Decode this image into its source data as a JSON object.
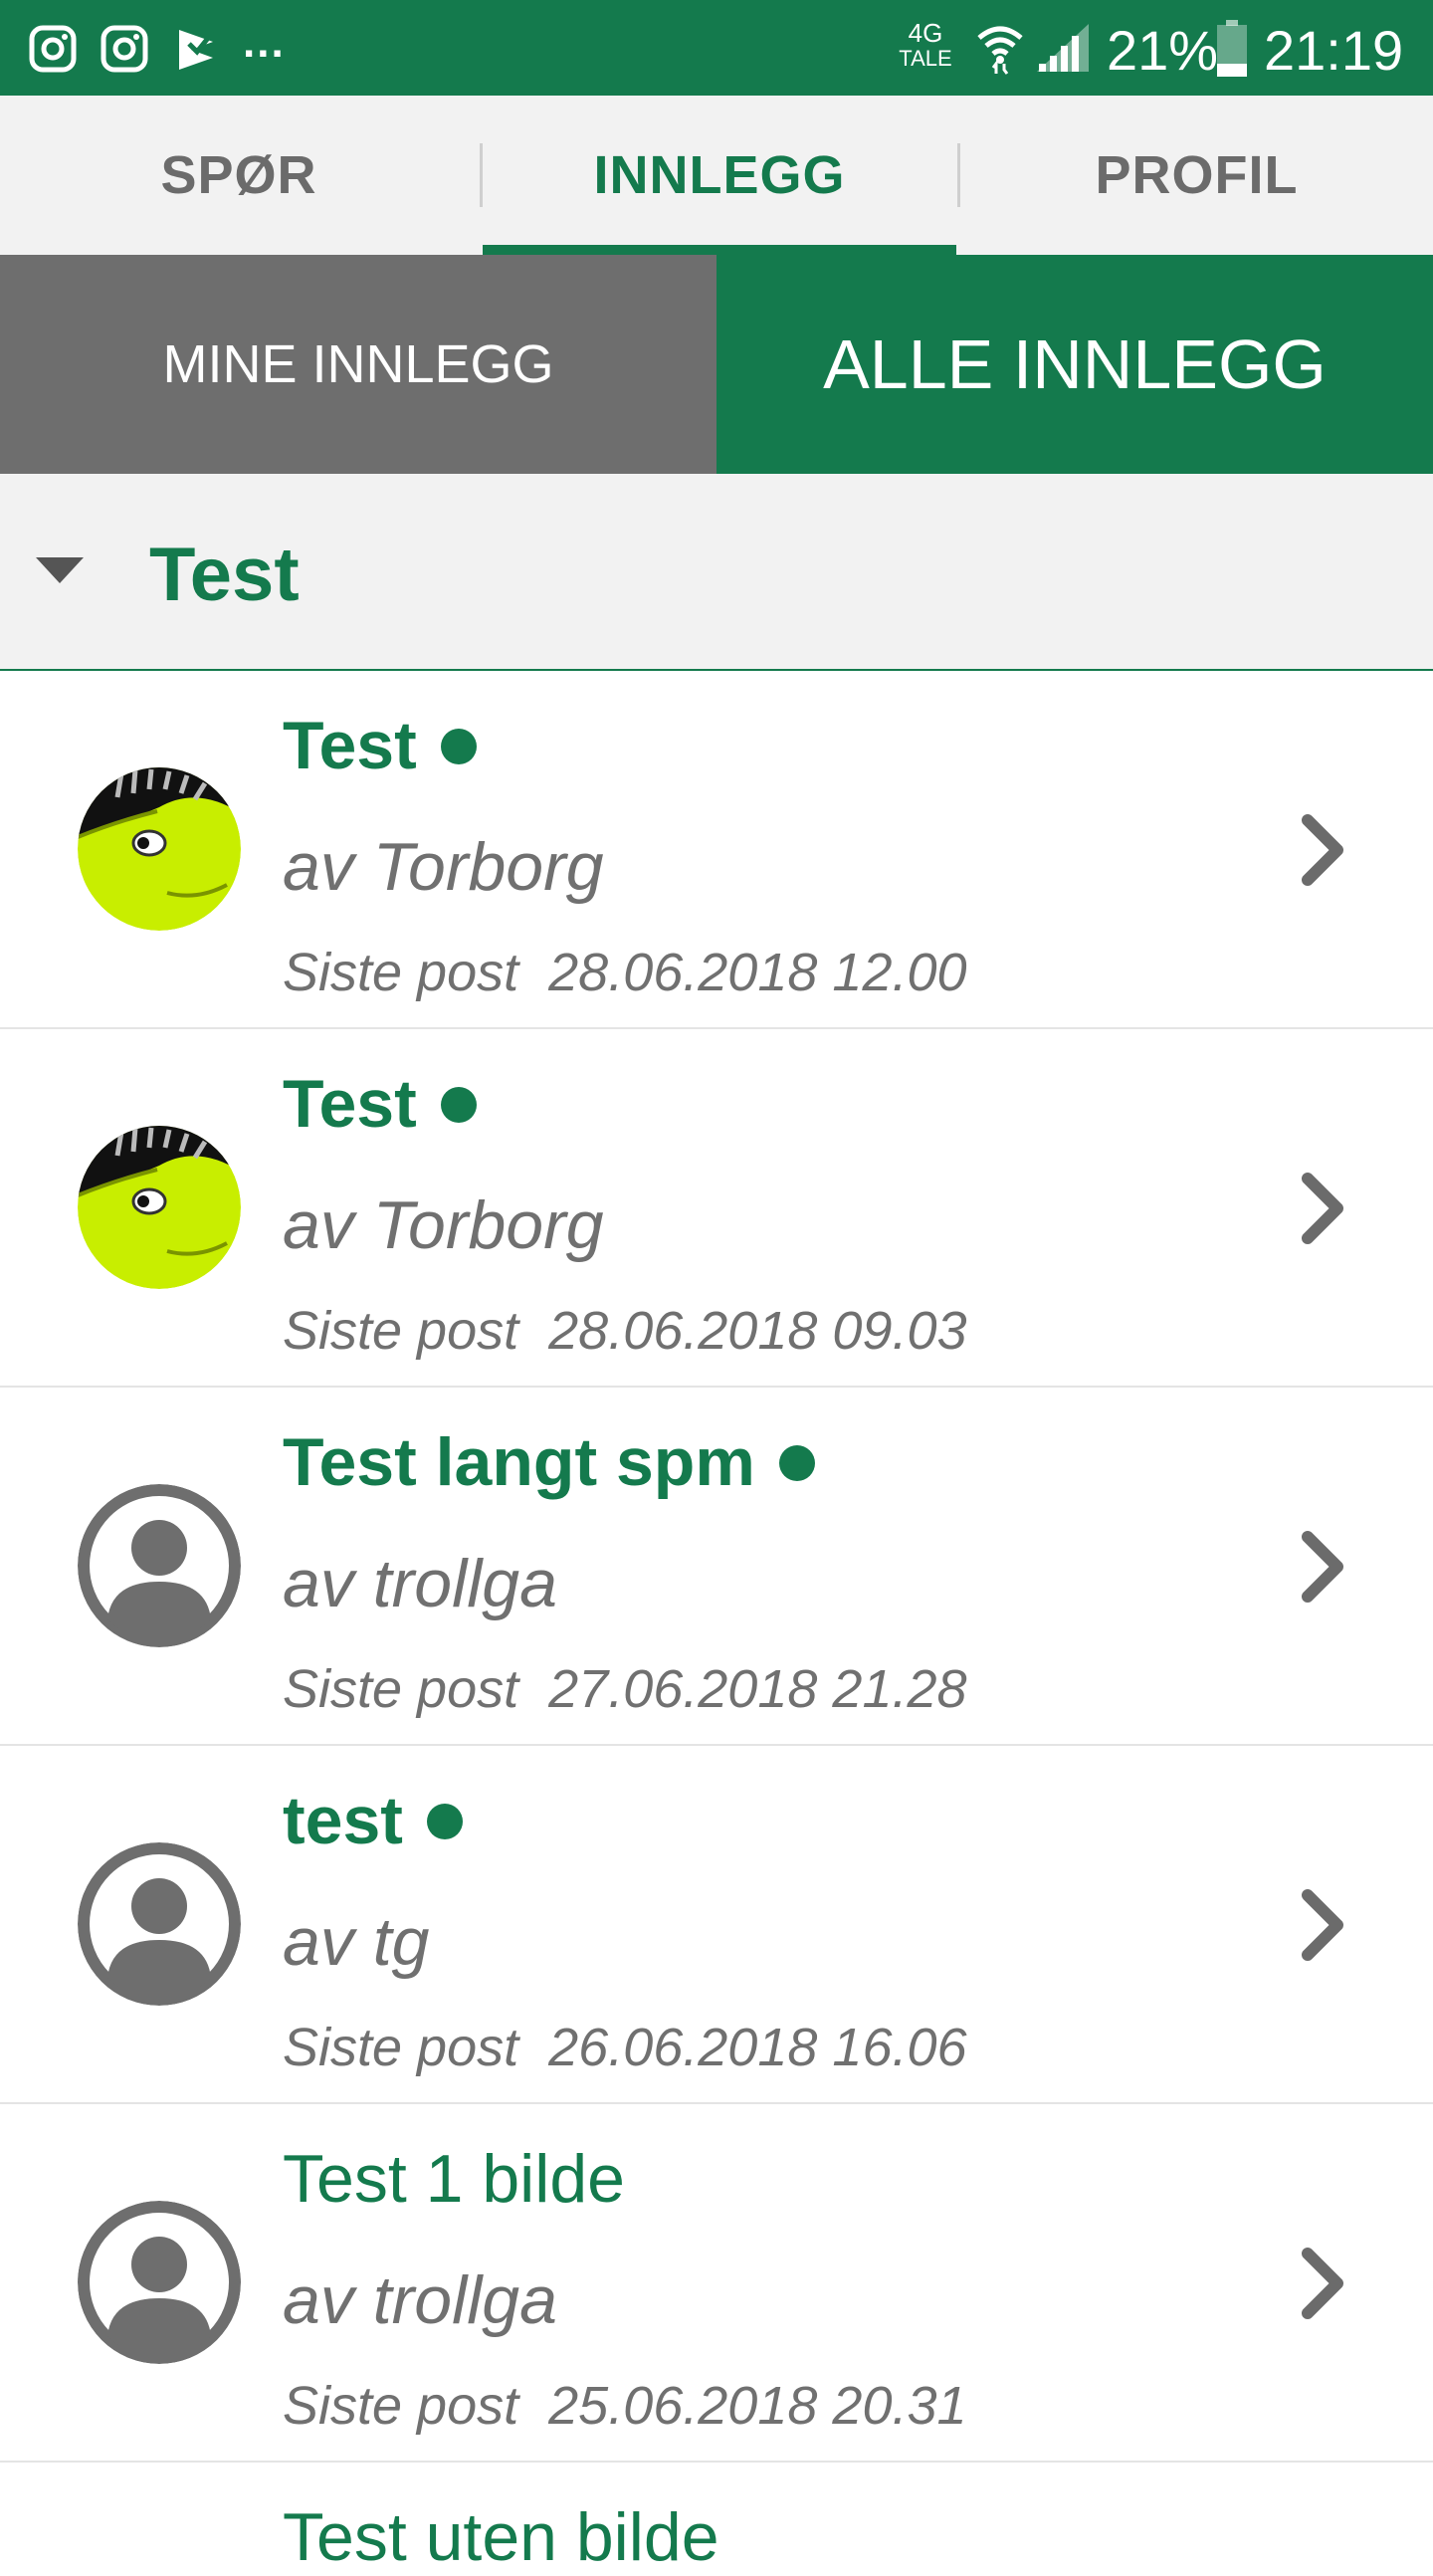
{
  "status_bar": {
    "network_top": "4G",
    "network_bottom": "TALE",
    "more_indicator": "...",
    "battery_percent": "21%",
    "time": "21:19",
    "icons": [
      "instagram-icon",
      "instagram-icon",
      "app-notification-icon",
      "wifi-icon",
      "signal-icon",
      "battery-icon"
    ]
  },
  "tabs": [
    {
      "label": "SPØR",
      "active": false
    },
    {
      "label": "INNLEGG",
      "active": true
    },
    {
      "label": "PROFIL",
      "active": false
    }
  ],
  "segment": {
    "mine_label": "MINE INNLEGG",
    "alle_label": "ALLE INNLEGG",
    "selected": "ALLE INNLEGG"
  },
  "group": {
    "title": "Test",
    "expanded": true
  },
  "posts": [
    {
      "title": "Test",
      "author_prefix": "av",
      "author": "Torborg",
      "date_prefix": "Siste post",
      "date": "28.06.2018 12.00",
      "unread": true,
      "avatar": "dinosaur-avatar"
    },
    {
      "title": "Test",
      "author_prefix": "av",
      "author": "Torborg",
      "date_prefix": "Siste post",
      "date": "28.06.2018 09.03",
      "unread": true,
      "avatar": "dinosaur-avatar"
    },
    {
      "title": "Test langt spm",
      "author_prefix": "av",
      "author": "trollga",
      "date_prefix": "Siste post",
      "date": "27.06.2018 21.28",
      "unread": true,
      "avatar": "default-user-avatar"
    },
    {
      "title": "test",
      "author_prefix": "av",
      "author": "tg",
      "date_prefix": "Siste post",
      "date": "26.06.2018 16.06",
      "unread": true,
      "avatar": "default-user-avatar"
    },
    {
      "title": "Test 1 bilde",
      "author_prefix": "av",
      "author": "trollga",
      "date_prefix": "Siste post",
      "date": "25.06.2018 20.31",
      "unread": false,
      "avatar": "default-user-avatar"
    },
    {
      "title": "Test uten bilde"
    }
  ],
  "colors": {
    "brand_green": "#147a4d",
    "segment_gray": "#6e6e6e",
    "text_gray": "#707070",
    "header_bg": "#f2f2f2"
  }
}
